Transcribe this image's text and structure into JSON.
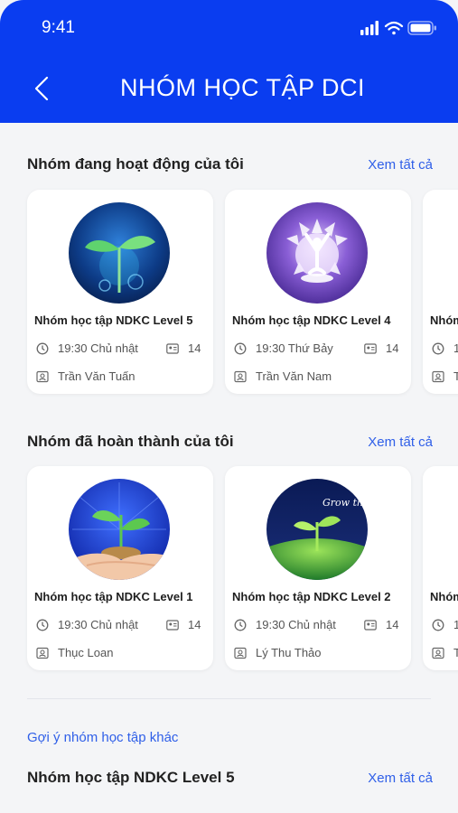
{
  "status": {
    "time": "9:41"
  },
  "header": {
    "title": "NHÓM HỌC TẬP DCI"
  },
  "colors": {
    "brand": "#0a3df0",
    "link": "#2f5fe8",
    "background": "#f4f5f7"
  },
  "icons": {
    "back": "chevron-left-icon",
    "clock": "clock-icon",
    "members": "member-count-icon",
    "mentor": "person-card-icon"
  },
  "active": {
    "title": "Nhóm đang hoạt động của tôi",
    "see_all": "Xem tất cả",
    "cards": [
      {
        "name": "Nhóm học tập NDKC Level 5",
        "schedule": "19:30 Chủ nhật",
        "members": "14",
        "mentor": "Trần Văn Tuấn"
      },
      {
        "name": "Nhóm học tập NDKC Level 4",
        "schedule": "19:30 Thứ Bảy",
        "members": "14",
        "mentor": "Trần Văn Nam"
      },
      {
        "name": "Nhóm",
        "schedule": "1",
        "members": "",
        "mentor": "T"
      }
    ]
  },
  "completed": {
    "title": "Nhóm đã hoàn thành của tôi",
    "see_all": "Xem tất cả",
    "cards": [
      {
        "name": "Nhóm học tập NDKC Level 1",
        "schedule": "19:30 Chủ nhật",
        "members": "14",
        "mentor": "Thục Loan"
      },
      {
        "name": "Nhóm học tập NDKC Level 2",
        "schedule": "19:30 Chủ nhật",
        "members": "14",
        "mentor": "Lý Thu Thảo"
      },
      {
        "name": "Nhóm",
        "schedule": "1",
        "members": "",
        "mentor": "T"
      }
    ],
    "card2_image_text": "Grow that"
  },
  "suggest": {
    "link": "Gợi ý nhóm học tập khác",
    "group_title": "Nhóm học tập NDKC Level 5",
    "see_all": "Xem tất cả"
  }
}
